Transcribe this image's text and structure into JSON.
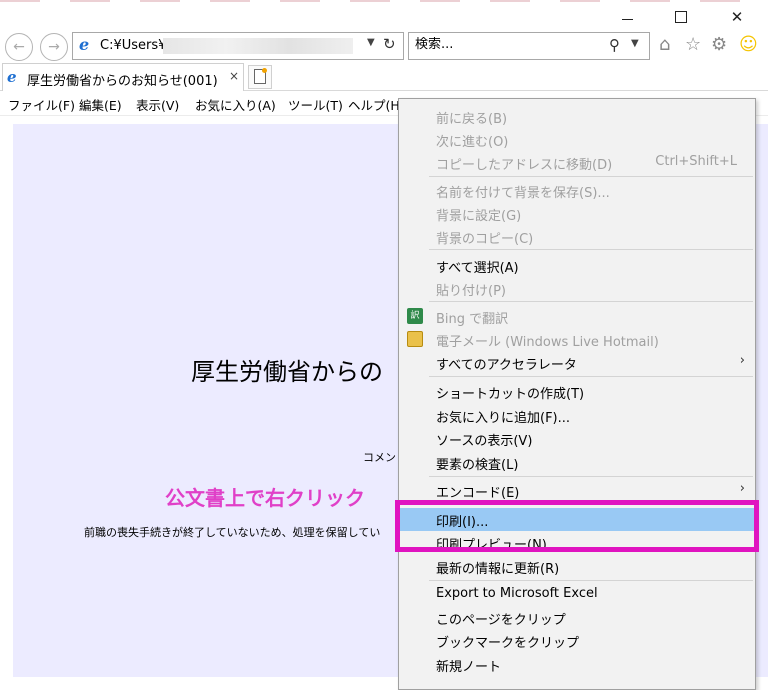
{
  "address": {
    "value": "C:¥Users¥"
  },
  "search": {
    "placeholder": "検索..."
  },
  "tab": {
    "label": "厚生労働省からのお知らせ(001)",
    "close": "×"
  },
  "window_controls": {
    "close": "✕"
  },
  "icons": {
    "back": "back-arrow-icon",
    "forward": "forward-arrow-icon",
    "home": "home-icon",
    "favorites": "star-icon",
    "tools": "gear-icon",
    "feedback": "smiley-icon"
  },
  "menubar": [
    "ファイル(F)",
    "編集(E)",
    "表示(V)",
    "お気に入り(A)",
    "ツール(T)",
    "ヘルプ(H)"
  ],
  "content": {
    "title": "厚生労働省からの",
    "comment_label": "コメン",
    "annotation": "公文書上で右クリック",
    "body_text": "前職の喪失手続きが終了していないため、処理を保留してい"
  },
  "context_menu": {
    "items": [
      {
        "label": "前に戻る(B)",
        "enabled": false
      },
      {
        "label": "次に進む(O)",
        "enabled": false
      },
      {
        "label": "コピーしたアドレスに移動(D)",
        "shortcut": "Ctrl+Shift+L",
        "enabled": false
      },
      {
        "label": "名前を付けて背景を保存(S)...",
        "enabled": false
      },
      {
        "label": "背景に設定(G)",
        "enabled": false
      },
      {
        "label": "背景のコピー(C)",
        "enabled": false
      },
      {
        "label": "すべて選択(A)",
        "enabled": true
      },
      {
        "label": "貼り付け(P)",
        "enabled": false
      },
      {
        "label": "Bing で翻訳",
        "enabled": false
      },
      {
        "label": "電子メール (Windows Live Hotmail)",
        "enabled": false
      },
      {
        "label": "すべてのアクセラレータ",
        "enabled": true,
        "submenu": true
      },
      {
        "label": "ショートカットの作成(T)",
        "enabled": true
      },
      {
        "label": "お気に入りに追加(F)...",
        "enabled": true
      },
      {
        "label": "ソースの表示(V)",
        "enabled": true
      },
      {
        "label": "要素の検査(L)",
        "enabled": true
      },
      {
        "label": "エンコード(E)",
        "enabled": true,
        "submenu": true
      },
      {
        "label": "印刷(I)...",
        "enabled": true,
        "highlighted": true
      },
      {
        "label": "印刷プレビュー(N)...",
        "enabled": true
      },
      {
        "label": "最新の情報に更新(R)",
        "enabled": true
      },
      {
        "label": "Export to Microsoft Excel",
        "enabled": true
      },
      {
        "label": "このページをクリップ",
        "enabled": true
      },
      {
        "label": "ブックマークをクリップ",
        "enabled": true
      },
      {
        "label": "新規ノート",
        "enabled": true
      }
    ],
    "submenu_arrow": "›"
  },
  "colors": {
    "highlight": "#99c9f4",
    "annotation": "#e040c8",
    "frame": "#e014c0",
    "content_bg": "#ecebff"
  }
}
